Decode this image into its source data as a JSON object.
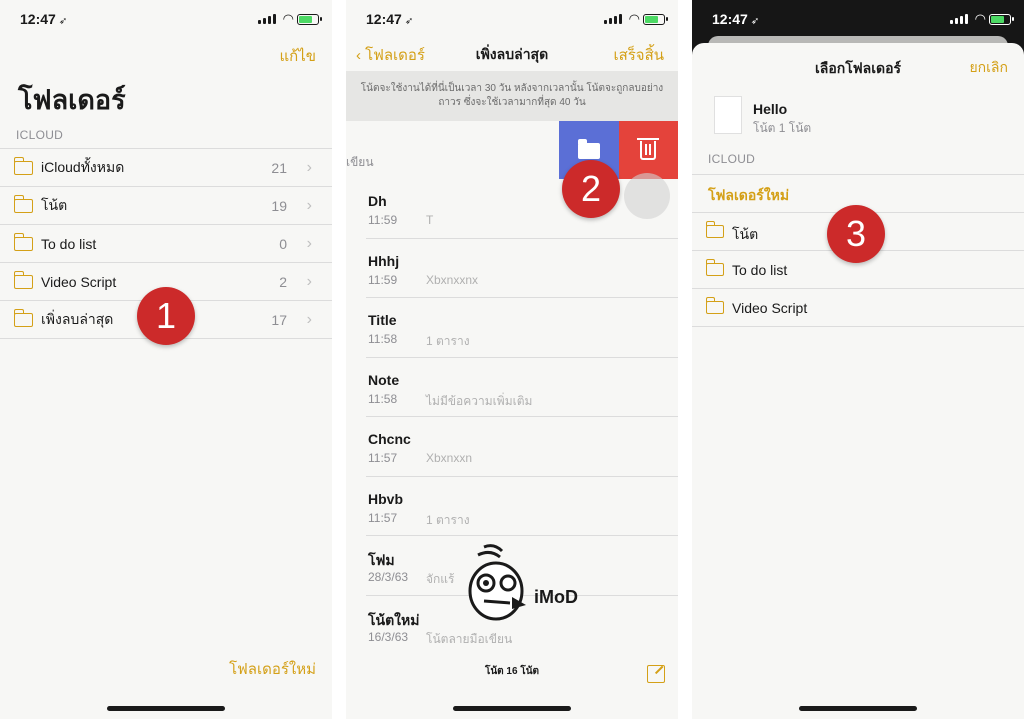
{
  "colors": {
    "accent": "#d4a017",
    "move_action": "#5b6fd6",
    "delete_action": "#e4433b",
    "badge": "#cc2a2a",
    "battery": "#4cd964"
  },
  "status": {
    "time": "12:47"
  },
  "panel1": {
    "edit": "แก้ไข",
    "title": "โฟลเดอร์",
    "section": "ICLOUD",
    "folders": [
      {
        "name": "iCloudทั้งหมด",
        "count": "21"
      },
      {
        "name": "โน้ต",
        "count": "19"
      },
      {
        "name": "To do list",
        "count": "0"
      },
      {
        "name": "Video Script",
        "count": "2"
      },
      {
        "name": "เพิ่งลบล่าสุด",
        "count": "17"
      }
    ],
    "new_folder": "โฟลเดอร์ใหม่",
    "badge": "1"
  },
  "panel2": {
    "back": "โฟลเดอร์",
    "title": "เพิ่งลบล่าสุด",
    "done": "เสร็จสิ้น",
    "banner": "โน้ตจะใช้งานได้ที่นี่เป็นเวลา 30 วัน หลังจากเวลานั้น โน้ตจะถูกลบอย่างถาวร ซึ่งจะใช้เวลามากที่สุด 40 วัน",
    "swiped_label": "เขียน",
    "notes": [
      {
        "title": "Dh",
        "date": "11:59",
        "preview": "T"
      },
      {
        "title": "Hhhj",
        "date": "11:59",
        "preview": "Xbxnxxnx"
      },
      {
        "title": "Title",
        "date": "11:58",
        "preview": "1 ตาราง"
      },
      {
        "title": "Note",
        "date": "11:58",
        "preview": "ไม่มีข้อความเพิ่มเติม"
      },
      {
        "title": "Chcnc",
        "date": "11:57",
        "preview": "Xbxnxxn"
      },
      {
        "title": "Hbvb",
        "date": "11:57",
        "preview": "1 ตาราง"
      },
      {
        "title": "โฟม",
        "date": "28/3/63",
        "preview": "จักแร้"
      },
      {
        "title": "โน้ตใหม่",
        "date": "16/3/63",
        "preview": "โน้ตลายมือเขียน"
      }
    ],
    "footer": "โน้ต 16 โน้ต",
    "badge": "2",
    "watermark": "iMoD"
  },
  "panel3": {
    "title": "เลือกโฟลเดอร์",
    "cancel": "ยกเลิก",
    "note_title": "Hello",
    "note_sub": "โน้ต 1 โน้ต",
    "section": "ICLOUD",
    "new_folder": "โฟลเดอร์ใหม่",
    "folders": [
      "โน้ต",
      "To do list",
      "Video Script"
    ],
    "badge": "3"
  }
}
